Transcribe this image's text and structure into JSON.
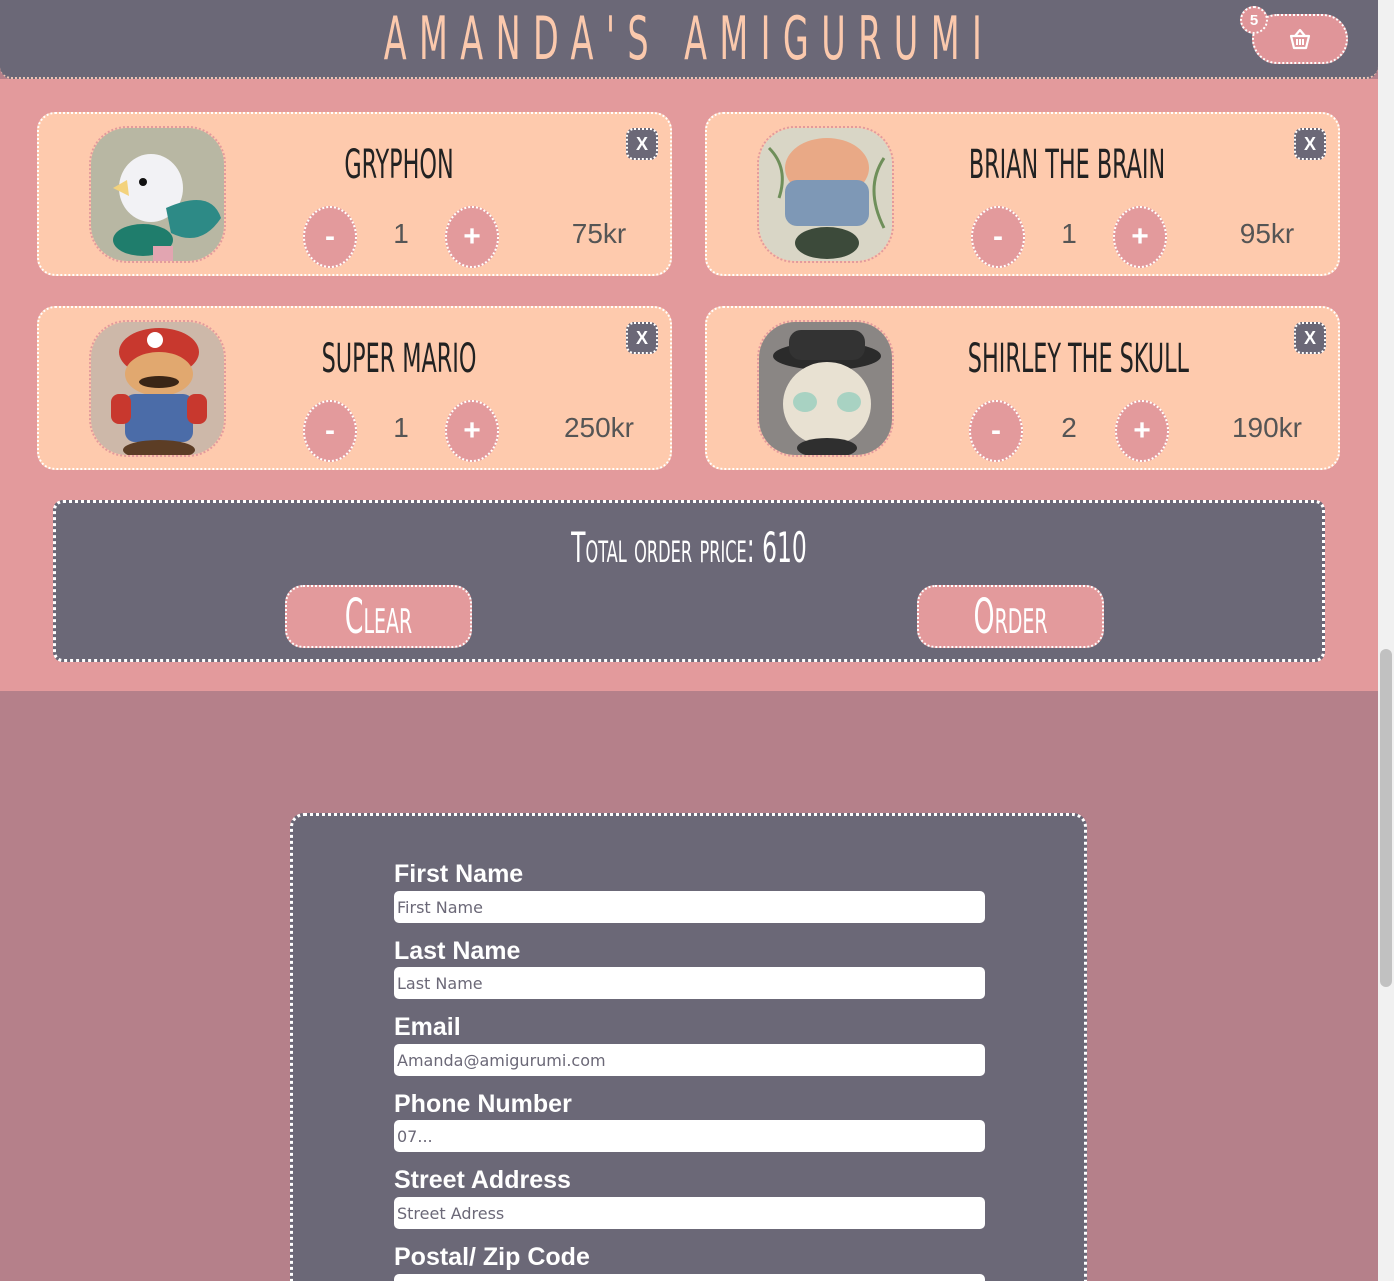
{
  "header": {
    "title": "Amanda's Amigurumi",
    "cart_count": "5"
  },
  "cart": {
    "items": [
      {
        "name": "Gryphon",
        "qty": "1",
        "price": "75kr",
        "minus": "-",
        "plus": "+",
        "remove": "X"
      },
      {
        "name": "Brian the brain",
        "qty": "1",
        "price": "95kr",
        "minus": "-",
        "plus": "+",
        "remove": "X"
      },
      {
        "name": "Super Mario",
        "qty": "1",
        "price": "250kr",
        "minus": "-",
        "plus": "+",
        "remove": "X"
      },
      {
        "name": "Shirley the skull",
        "qty": "2",
        "price": "190kr",
        "minus": "-",
        "plus": "+",
        "remove": "X"
      }
    ],
    "total_text": "Total order price: 610",
    "clear_label": "Clear",
    "order_label": "Order"
  },
  "form": {
    "fields": [
      {
        "label": "First Name",
        "placeholder": "First Name"
      },
      {
        "label": "Last Name",
        "placeholder": "Last Name"
      },
      {
        "label": "Email",
        "placeholder": "Amanda@amigurumi.com"
      },
      {
        "label": "Phone Number",
        "placeholder": "07..."
      },
      {
        "label": "Street Address",
        "placeholder": "Street Adress"
      },
      {
        "label": "Postal/ Zip Code",
        "placeholder": ""
      }
    ]
  },
  "colors": {
    "header_bg": "#6b6877",
    "cart_bg": "#e39a9c",
    "card_bg": "#fecaad",
    "page_bg": "#b5808a",
    "title_color": "#fbc9ad"
  }
}
